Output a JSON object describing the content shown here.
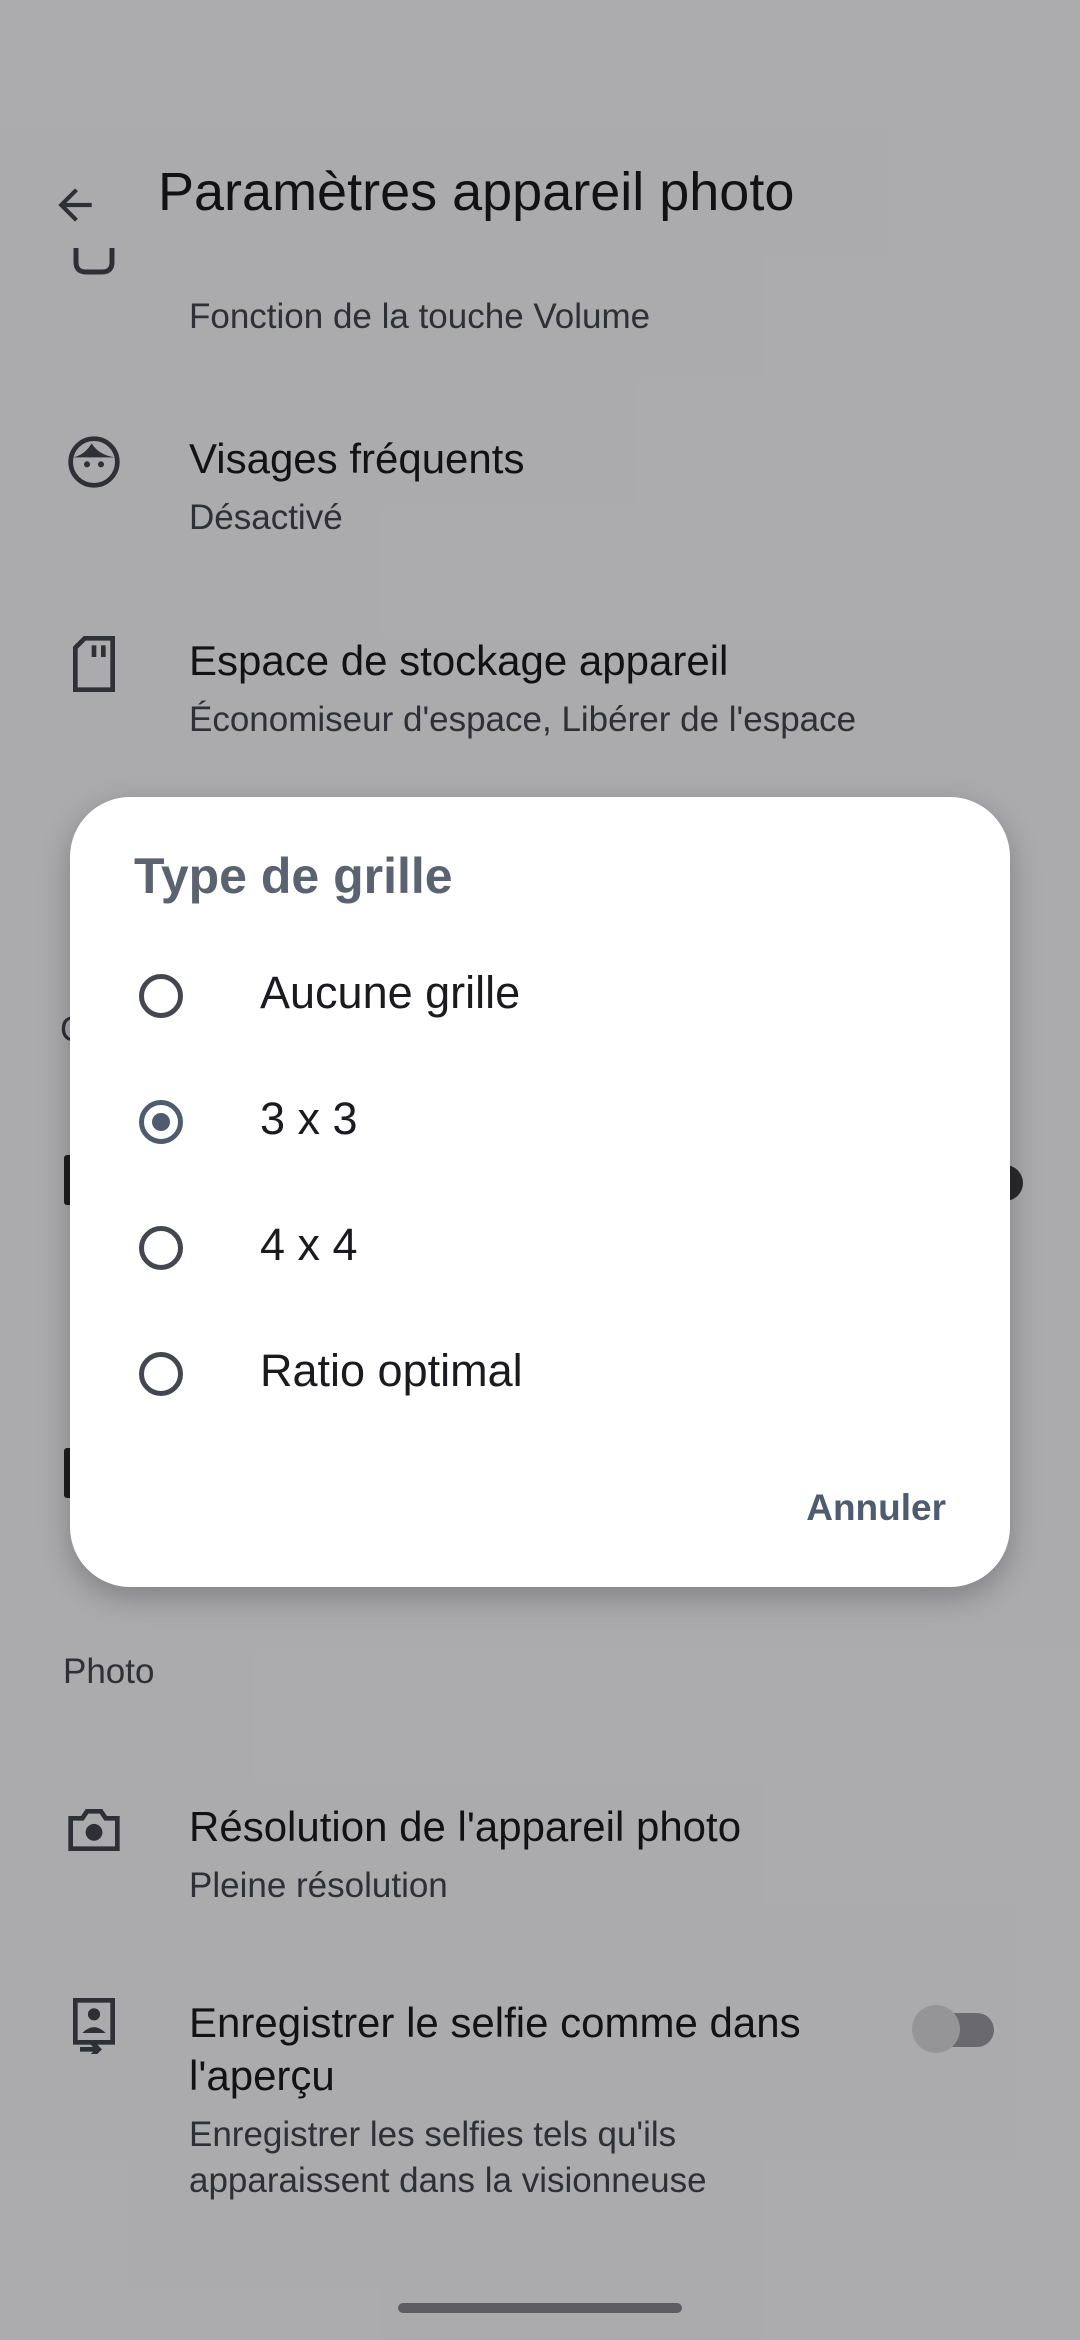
{
  "appbar": {
    "title": "Paramètres appareil photo"
  },
  "settings": {
    "volume_key": {
      "secondary": "Fonction de la touche Volume"
    },
    "frequent_faces": {
      "primary": "Visages fréquents",
      "secondary": "Désactivé"
    },
    "storage": {
      "primary": "Espace de stockage appareil",
      "secondary": "Économiseur d'espace, Libérer de l'espace"
    },
    "photo_section": "Photo",
    "resolution": {
      "primary": "Résolution de l'appareil photo",
      "secondary": "Pleine résolution"
    },
    "selfie": {
      "primary_line1": "Enregistrer le selfie comme dans",
      "primary_line2": "l'aperçu",
      "secondary_line1": "Enregistrer les selfies tels qu'ils",
      "secondary_line2": "apparaissent dans la visionneuse",
      "toggle_on": false
    }
  },
  "dialog": {
    "title": "Type de grille",
    "options": [
      {
        "label": "Aucune grille",
        "selected": false
      },
      {
        "label": "3 x 3",
        "selected": true
      },
      {
        "label": "4 x 4",
        "selected": false
      },
      {
        "label": "Ratio optimal",
        "selected": false
      }
    ],
    "cancel_label": "Annuler"
  },
  "background_fragments": {
    "left_char": "C"
  },
  "icons": {
    "back": "arrow-left-icon",
    "frequent_faces": "face-icon",
    "storage": "sd-card-icon",
    "resolution": "camera-icon",
    "selfie": "selfie-icon"
  }
}
